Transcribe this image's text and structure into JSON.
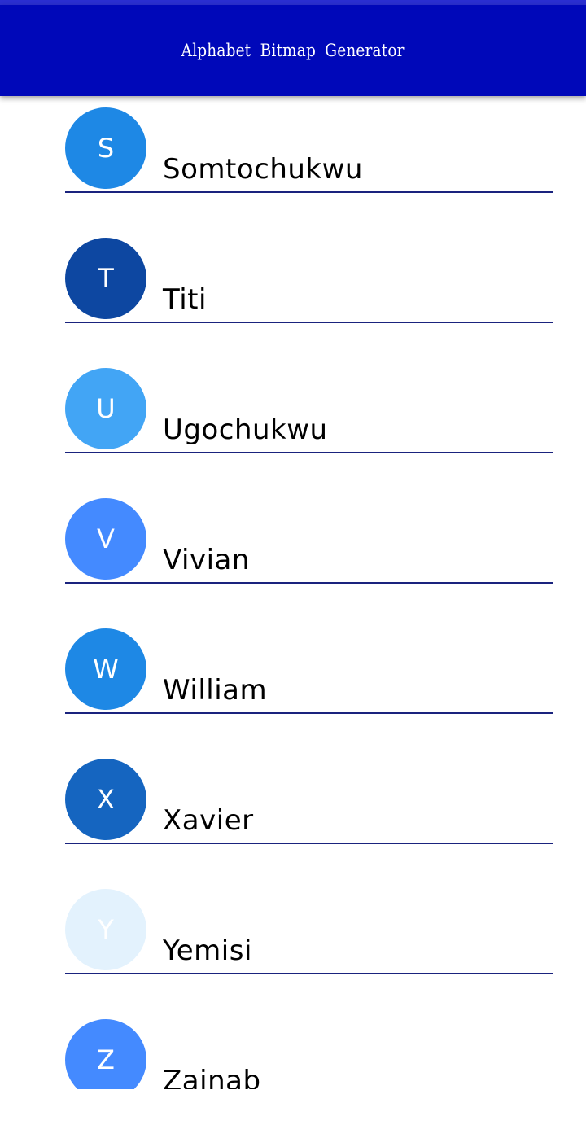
{
  "app": {
    "title": "Alphabet Bitmap Generator"
  },
  "contacts": [
    {
      "letter": "S",
      "name": "Somtochukwu",
      "color": "#1e88e5"
    },
    {
      "letter": "T",
      "name": "Titi",
      "color": "#0d47a1"
    },
    {
      "letter": "U",
      "name": "Ugochukwu",
      "color": "#42a5f5"
    },
    {
      "letter": "V",
      "name": "Vivian",
      "color": "#448aff"
    },
    {
      "letter": "W",
      "name": "William",
      "color": "#1e88e5"
    },
    {
      "letter": "X",
      "name": "Xavier",
      "color": "#1565c0"
    },
    {
      "letter": "Y",
      "name": "Yemisi",
      "color": "#e3f2fd"
    },
    {
      "letter": "Z",
      "name": "Zainab",
      "color": "#448aff"
    }
  ],
  "colors": {
    "appbar": "#0008b9",
    "statusbar": "#2a2fd0",
    "divider": "#1a237e"
  }
}
